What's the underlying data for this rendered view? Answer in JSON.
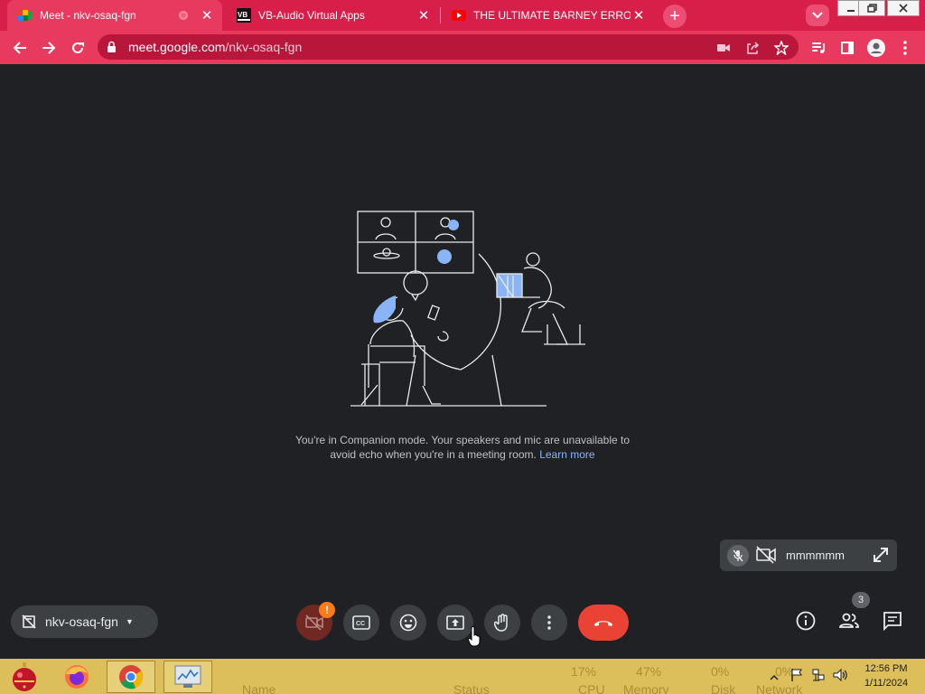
{
  "browser": {
    "tabs": [
      {
        "title": "Meet - nkv-osaq-fgn",
        "active": true
      },
      {
        "title": "VB-Audio Virtual Apps",
        "active": false
      },
      {
        "title": "THE ULTIMATE BARNEY ERROR -",
        "active": false
      }
    ],
    "url_host": "meet.google.com",
    "url_path": "/nkv-osaq-fgn",
    "theme_color": "#d81f4a"
  },
  "meet": {
    "message_line1": "You're in Companion mode. Your speakers and mic are unavailable to",
    "message_line2": "avoid echo when you're in a meeting room.",
    "learn_more": "Learn more",
    "self_name": "mmmmmm",
    "meeting_code": "nkv-osaq-fgn",
    "warning_badge": "!",
    "people_count": "3"
  },
  "taskbar": {
    "ghost": {
      "name": "Name",
      "status": "Status",
      "cpu_pct": "17%",
      "cpu": "CPU",
      "memory_pct": "47%",
      "memory": "Memory",
      "disk_pct": "0%",
      "disk": "Disk",
      "network_pct": "0%",
      "network": "Network"
    },
    "time": "12:56 PM",
    "date": "1/11/2024"
  }
}
